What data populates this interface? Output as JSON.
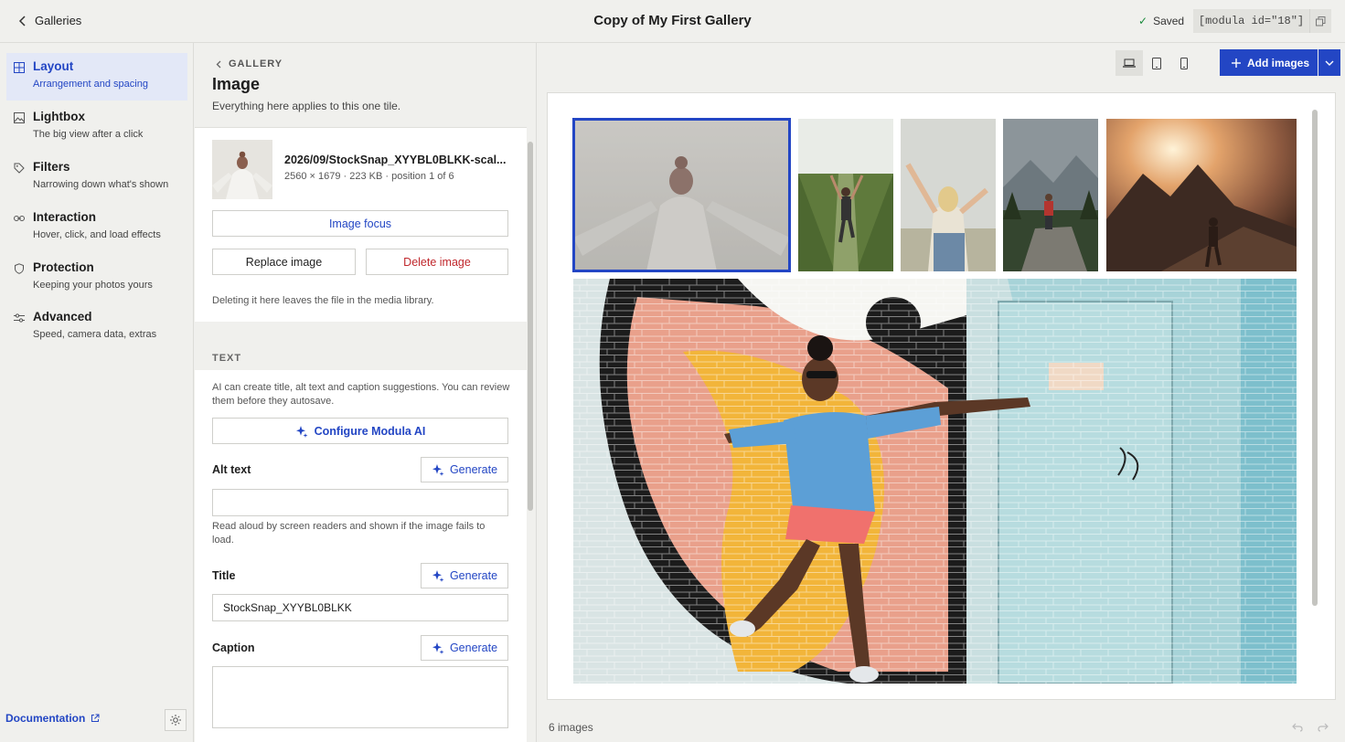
{
  "topbar": {
    "back_label": "Galleries",
    "title": "Copy of My First Gallery",
    "saved_label": "Saved",
    "shortcode": "[modula id=\"18\"]"
  },
  "nav": {
    "items": [
      {
        "label": "Layout",
        "sub": "Arrangement and spacing",
        "icon": "grid-icon"
      },
      {
        "label": "Lightbox",
        "sub": "The big view after a click",
        "icon": "image-icon"
      },
      {
        "label": "Filters",
        "sub": "Narrowing down what's shown",
        "icon": "tag-icon"
      },
      {
        "label": "Interaction",
        "sub": "Hover, click, and load effects",
        "icon": "link-icon"
      },
      {
        "label": "Protection",
        "sub": "Keeping your photos yours",
        "icon": "shield-icon"
      },
      {
        "label": "Advanced",
        "sub": "Speed, camera data, extras",
        "icon": "sliders-icon"
      }
    ],
    "documentation": "Documentation"
  },
  "panel": {
    "crumb": "GALLERY",
    "title": "Image",
    "subtitle": "Everything here applies to this one tile.",
    "file_name": "2026/09/StockSnap_XYYBL0BLKK-scal...",
    "file_meta": "2560 × 1679 · 223 KB · position 1 of 6",
    "focus_button": "Image focus",
    "replace_button": "Replace image",
    "delete_button": "Delete image",
    "delete_note": "Deleting it here leaves the file in the media library.",
    "text_section": "TEXT",
    "ai_hint": "AI can create title, alt text and caption suggestions. You can review them before they autosave.",
    "configure_ai": "Configure Modula AI",
    "alt_label": "Alt text",
    "alt_value": "",
    "alt_hint": "Read aloud by screen readers and shown if the image fails to load.",
    "title_label": "Title",
    "title_value": "StockSnap_XYYBL0BLKK",
    "caption_label": "Caption",
    "caption_value": "",
    "generate_label": "Generate"
  },
  "main": {
    "add_images": "Add images",
    "image_count": "6 images",
    "accent_color": "#2346c4"
  }
}
